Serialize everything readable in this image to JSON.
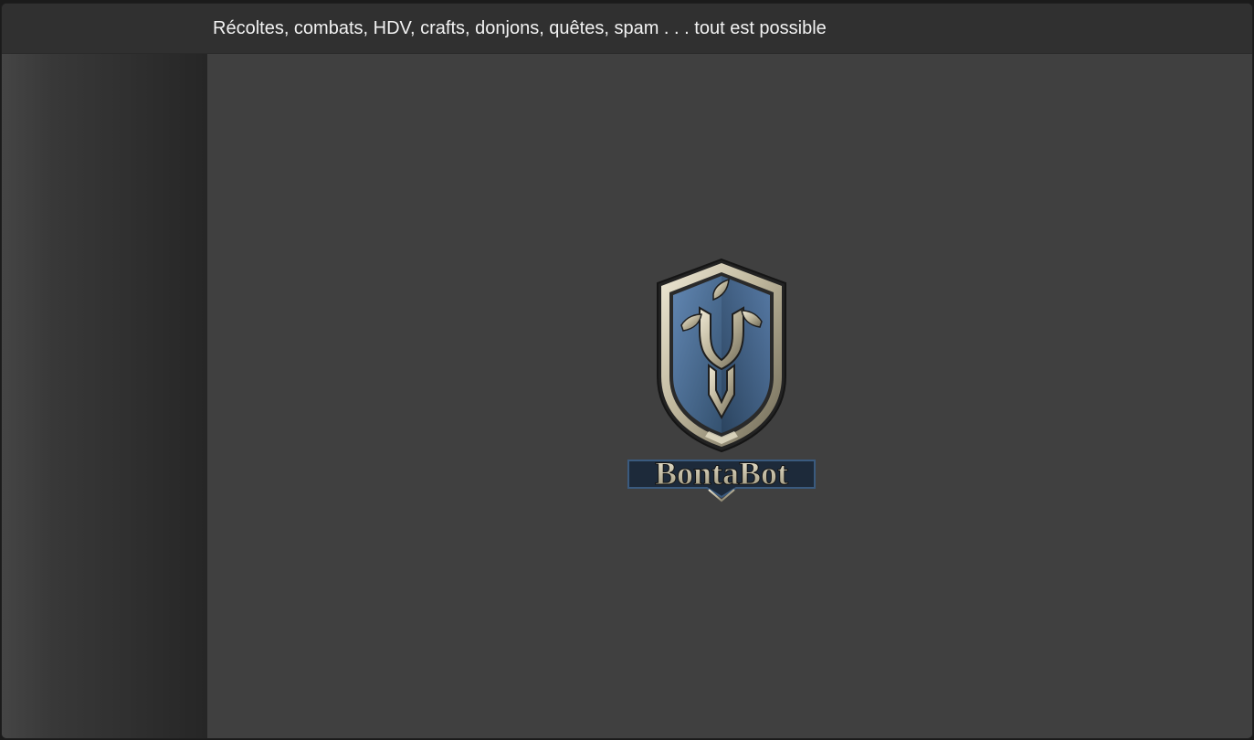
{
  "header": {
    "tagline": "Récoltes, combats, HDV, crafts, donjons, quêtes, spam . . . tout est possible"
  },
  "logo": {
    "name": "shield-logo-icon",
    "wordmark": "BontaBot",
    "colors": {
      "shield_blue": "#4a6c95",
      "metal": "#c9c2aa",
      "banner_outline": "#1d2a3a"
    }
  },
  "theme": {
    "background": "#404040",
    "topbar": "#303030",
    "text": "#f2f2f2"
  }
}
